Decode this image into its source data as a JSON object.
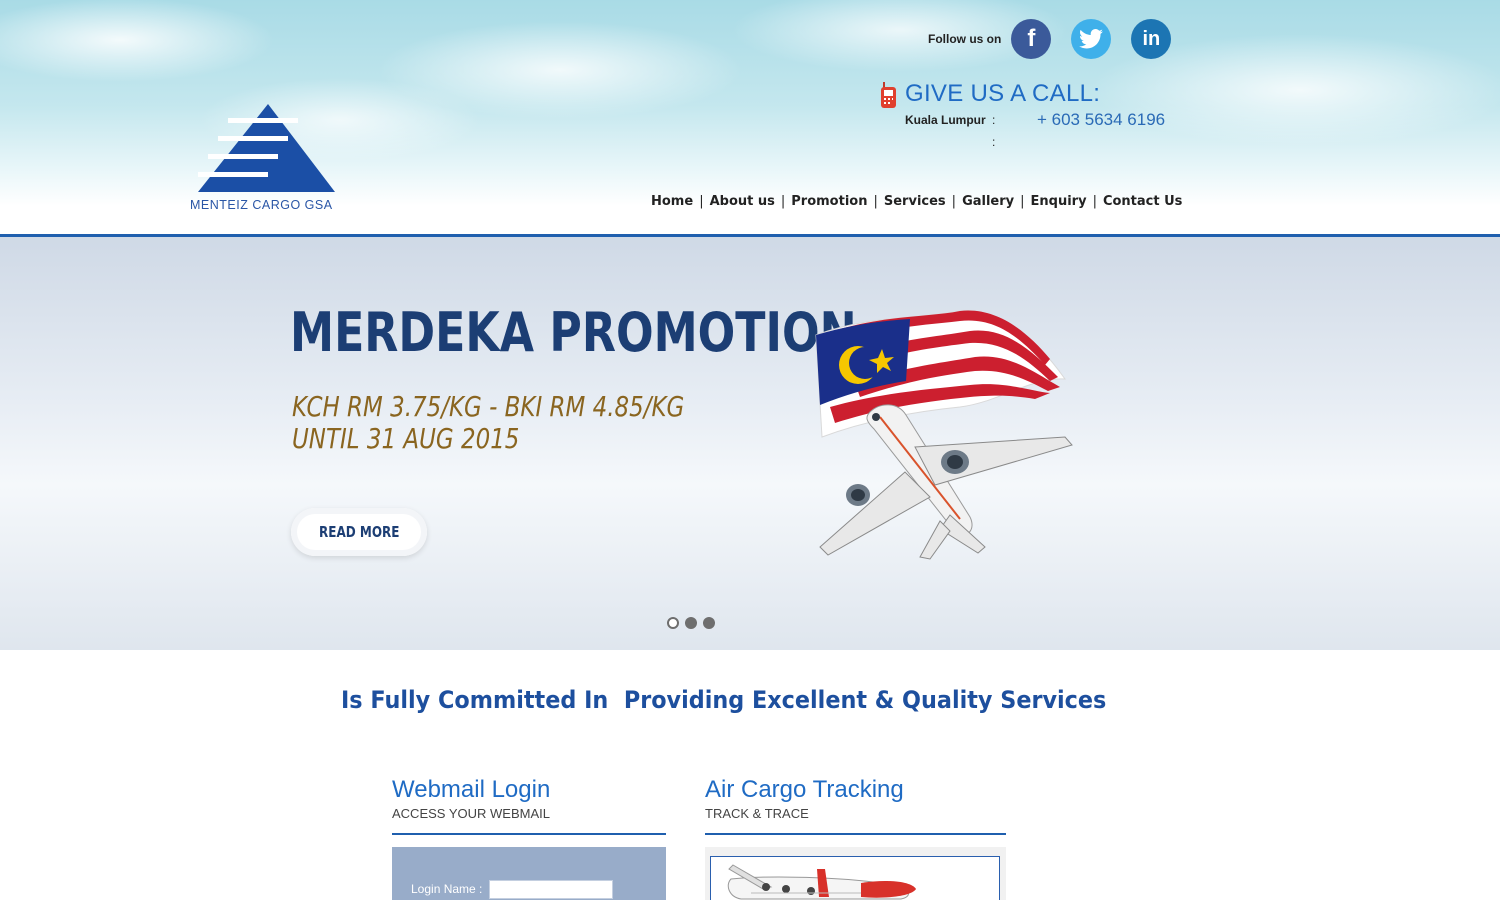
{
  "brand": {
    "name": "MENTEIZ CARGO GSA",
    "color": "#1b4fa6"
  },
  "social": {
    "label": "Follow us on",
    "facebook_icon": "facebook-icon",
    "twitter_icon": "twitter-icon",
    "linkedin_icon": "linkedin-icon",
    "facebook_glyph": "f",
    "linkedin_glyph": "in"
  },
  "call": {
    "title": "GIVE US A CALL:",
    "city": "Kuala Lumpur",
    "colon": ":",
    "number": "+ 603 5634 6196",
    "icon": "mobile-phone-icon"
  },
  "nav": {
    "items": [
      "Home",
      "About us",
      "Promotion",
      "Services",
      "Gallery",
      "Enquiry",
      "Contact Us"
    ],
    "separator": "|"
  },
  "hero": {
    "title": "MERDEKA PROMOTION",
    "line1": "KCH RM 3.75/KG - BKI RM 4.85/KG",
    "line2": "UNTIL 31 AUG 2015",
    "button": "READ MORE",
    "slides": 3,
    "active_slide": 1
  },
  "tagline": "Is Fully Committed In  Providing Excellent & Quality Services",
  "webmail": {
    "title": "Webmail Login",
    "subtitle": "ACCESS YOUR WEBMAIL",
    "login_label": "Login Name :",
    "login_value": ""
  },
  "tracking": {
    "title": "Air Cargo Tracking",
    "subtitle": "TRACK & TRACE"
  },
  "colors": {
    "accent_blue": "#1f5fae",
    "title_navy": "#1c3e74",
    "promo_gold": "#8a6520"
  }
}
